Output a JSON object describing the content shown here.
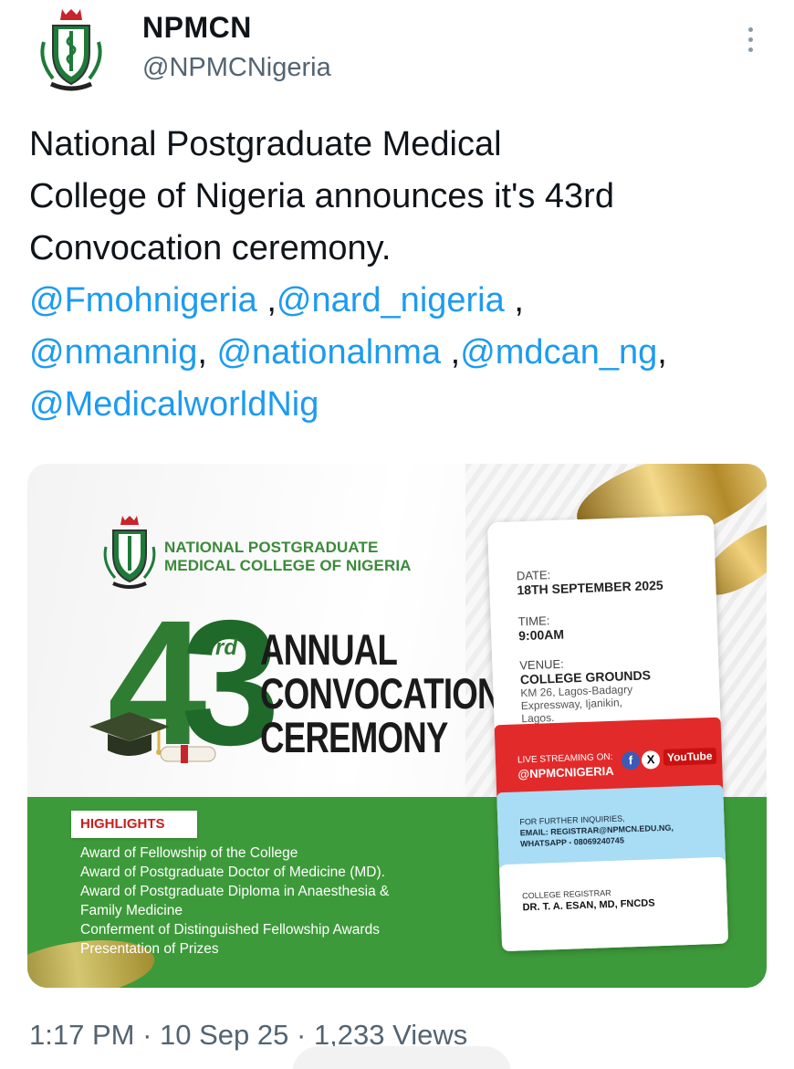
{
  "header": {
    "avatar_icon": "npmcn-crest-icon",
    "display_name": "NPMCN",
    "handle": "@NPMCNigeria",
    "more_icon": "more-options-icon"
  },
  "tweet": {
    "text_line1": "National Postgraduate Medical",
    "text_line2": "College of Nigeria announces it's 43rd",
    "text_line3": "Convocation ceremony.",
    "mentions": {
      "m1": "@Fmohnigeria",
      "sep1": " ,",
      "m2": "@nard_nigeria",
      "sep2": " ,",
      "m3": "@nmannig",
      "sep3": ", ",
      "m4": "@nationalnma",
      "sep4": " ,",
      "m5": "@mdcan_ng",
      "sep5": ",",
      "m6": "@MedicalworldNig"
    }
  },
  "flyer": {
    "college_line1": "NATIONAL POSTGRADUATE",
    "college_line2": "MEDICAL COLLEGE OF NIGERIA",
    "number": "43",
    "number_tens": "4",
    "number_units": "3",
    "ordinal": "rd",
    "title_line1": "ANNUAL",
    "title_line2": "CONVOCATION",
    "title_line3": "CEREMONY",
    "date_label": "DATE:",
    "date_value": "18TH SEPTEMBER 2025",
    "time_label": "TIME:",
    "time_value": "9:00AM",
    "venue_label": "VENUE:",
    "venue_value": "COLLEGE GROUNDS",
    "venue_addr1": "KM 26, Lagos-Badagry",
    "venue_addr2": "Expressway, Ijanikin,",
    "venue_addr3": "Lagos.",
    "stream_label": "LIVE STREAMING ON:",
    "stream_handle": "@NPMCNIGERIA",
    "stream_fb": "f",
    "stream_x": "X",
    "stream_youtube": "YouTube",
    "inquiries_label": "FOR FURTHER INQUIRIES,",
    "inquiries_email": "EMAIL: REGISTRAR@NPMCN.EDU.NG,",
    "inquiries_whatsapp": "WHATSAPP - 08069240745",
    "registrar_label": "COLLEGE REGISTRAR",
    "registrar_name": "DR. T. A. ESAN, MD, FNCDS",
    "highlights_label": "HIGHLIGHTS",
    "highlights": [
      "Award of Fellowship of the College",
      "Award of Postgraduate Doctor of Medicine (MD).",
      "Award of Postgraduate Diploma in Anaesthesia &",
      "Family Medicine",
      "Conferment of Distinguished Fellowship Awards",
      "Presentation of Prizes"
    ]
  },
  "meta": {
    "time": "1:17 PM",
    "sep": " · ",
    "date": "10 Sep 25",
    "sep2": " · ",
    "views": "1,233 Views"
  }
}
